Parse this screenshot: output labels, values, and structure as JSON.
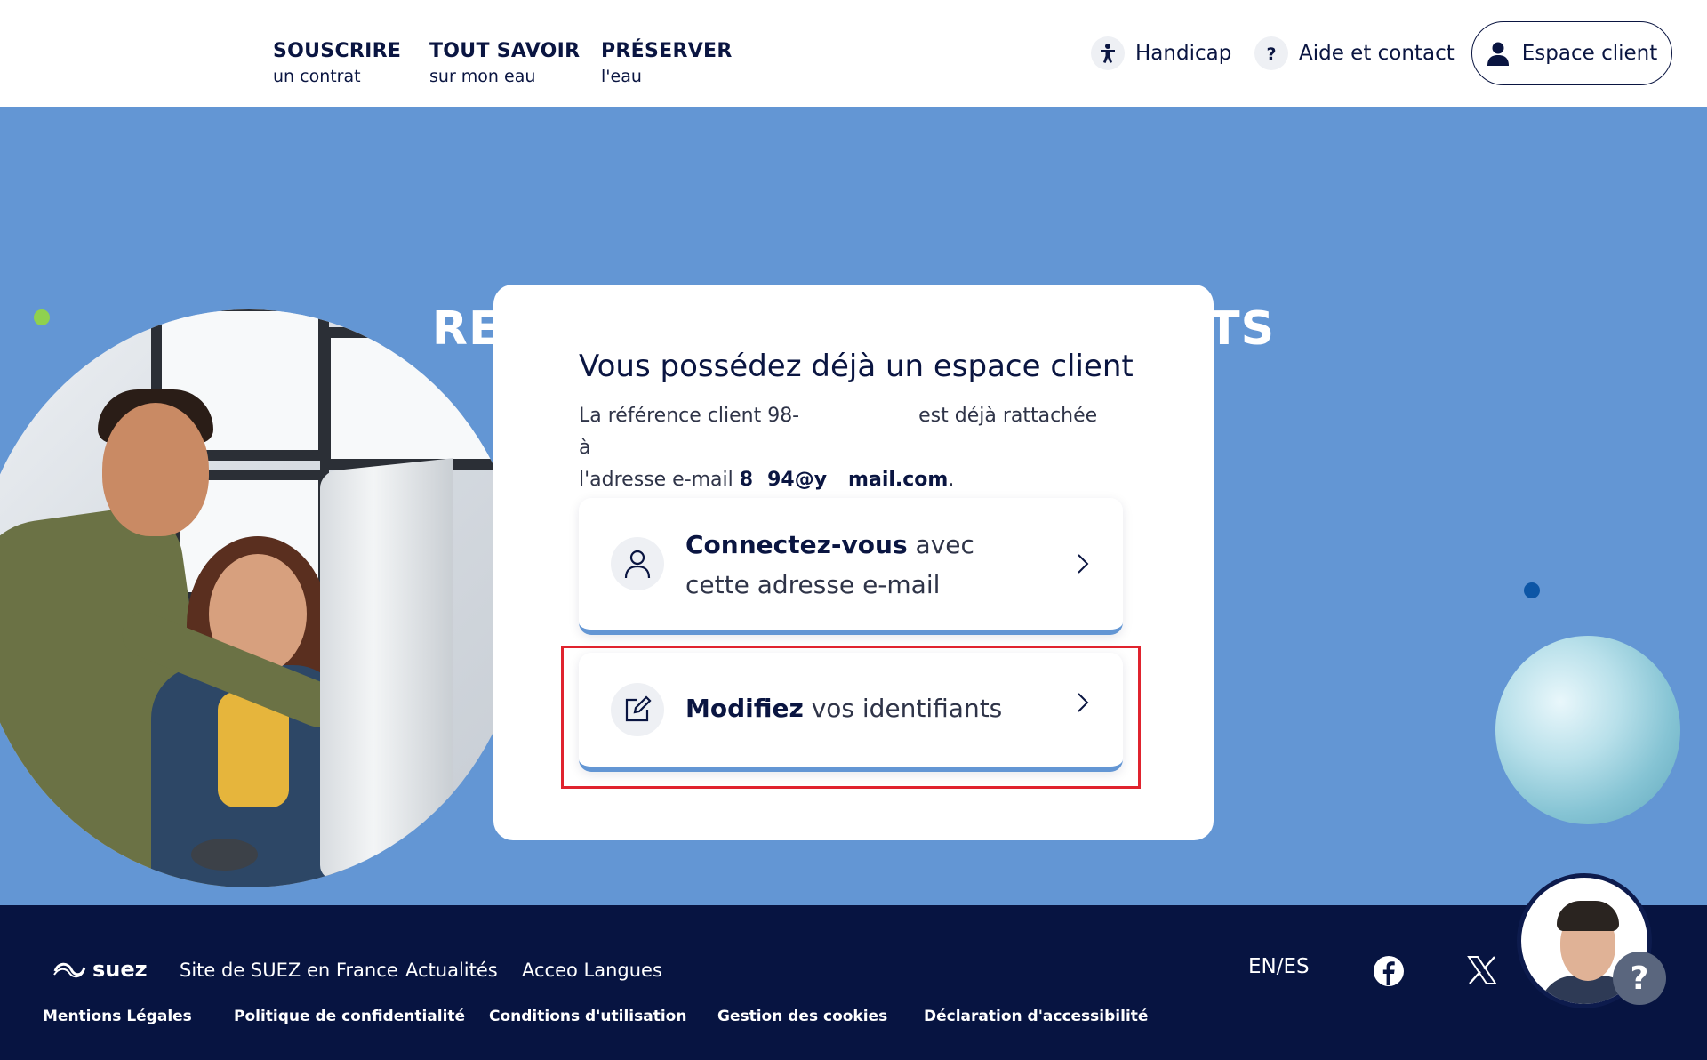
{
  "nav": {
    "items": [
      {
        "main": "SOUSCRIRE",
        "sub": "un contrat"
      },
      {
        "main": "TOUT SAVOIR",
        "sub": "sur mon eau"
      },
      {
        "main": "PRÉSERVER",
        "sub": "l'eau"
      }
    ],
    "handicap": "Handicap",
    "aide": "Aide et contact",
    "espace_client": "Espace client"
  },
  "hero": {
    "title": "RETROUVER MES IDENTIFIANTS"
  },
  "card": {
    "title": "Vous possédez déjà un espace client",
    "text_ref_prefix": "La référence client 98-",
    "text_ref_suffix": "est déjà rattachée à",
    "text_email_prefix": "l'adresse e-mail",
    "email_part1": "8",
    "email_part2": "94@y",
    "email_part3": "mail.com",
    "email_end": ".",
    "option1_bold": "Connectez-vous",
    "option1_rest": "avec cette adresse e-mail",
    "option2_bold": "Modifiez",
    "option2_rest": "vos identifiants"
  },
  "footer": {
    "logo": "suez",
    "links": [
      "Site de SUEZ en France",
      "Actualités",
      "Acceo Langues"
    ],
    "legal": [
      "Mentions Légales",
      "Politique de confidentialité",
      "Conditions d'utilisation",
      "Gestion des cookies",
      "Déclaration d'accessibilité"
    ],
    "lang": "EN/ES",
    "social": [
      "facebook-icon",
      "x-icon"
    ]
  },
  "chat": {
    "help": "?"
  },
  "colors": {
    "hero_bg": "#6396d4",
    "navy": "#0a1541",
    "footer_bg": "#071441",
    "highlight": "#e0232e",
    "accent_green": "#8fd14f"
  }
}
